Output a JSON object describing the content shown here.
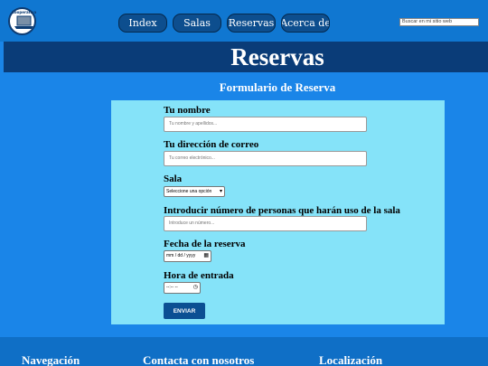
{
  "header": {
    "logo_text": "Cooperativa",
    "nav": [
      {
        "label": "Index"
      },
      {
        "label": "Salas"
      },
      {
        "label": "Reservas"
      },
      {
        "label": "Acerca de"
      }
    ],
    "search_placeholder": "Buscar en mi sitio web"
  },
  "banner": {
    "title": "Reservas"
  },
  "form": {
    "title": "Formulario de Reserva",
    "name_label": "Tu nombre",
    "name_placeholder": "Tu nombre y apellidos...",
    "email_label": "Tu dirección de correo",
    "email_placeholder": "Tu correo electrónico...",
    "room_label": "Sala",
    "room_selected": "Seleccione una opción",
    "people_label": "Introducir número de personas que harán uso de la sala",
    "people_placeholder": "Introduce un número...",
    "date_label": "Fecha de la reserva",
    "date_value": "mm / dd / yyyy",
    "time_label": "Hora de entrada",
    "time_value": "--:-- --",
    "submit_label": "ENVIAR"
  },
  "footer": {
    "col1": "Navegación",
    "col2": "Contacta con nosotros",
    "col3": "Localización"
  },
  "colors": {
    "page_bg": "#1a85e8",
    "topbar": "#1077d1",
    "banner": "#0a3c78",
    "nav_button": "#0d4e8e",
    "form_bg": "#85e3f9",
    "submit": "#0b4f93"
  }
}
